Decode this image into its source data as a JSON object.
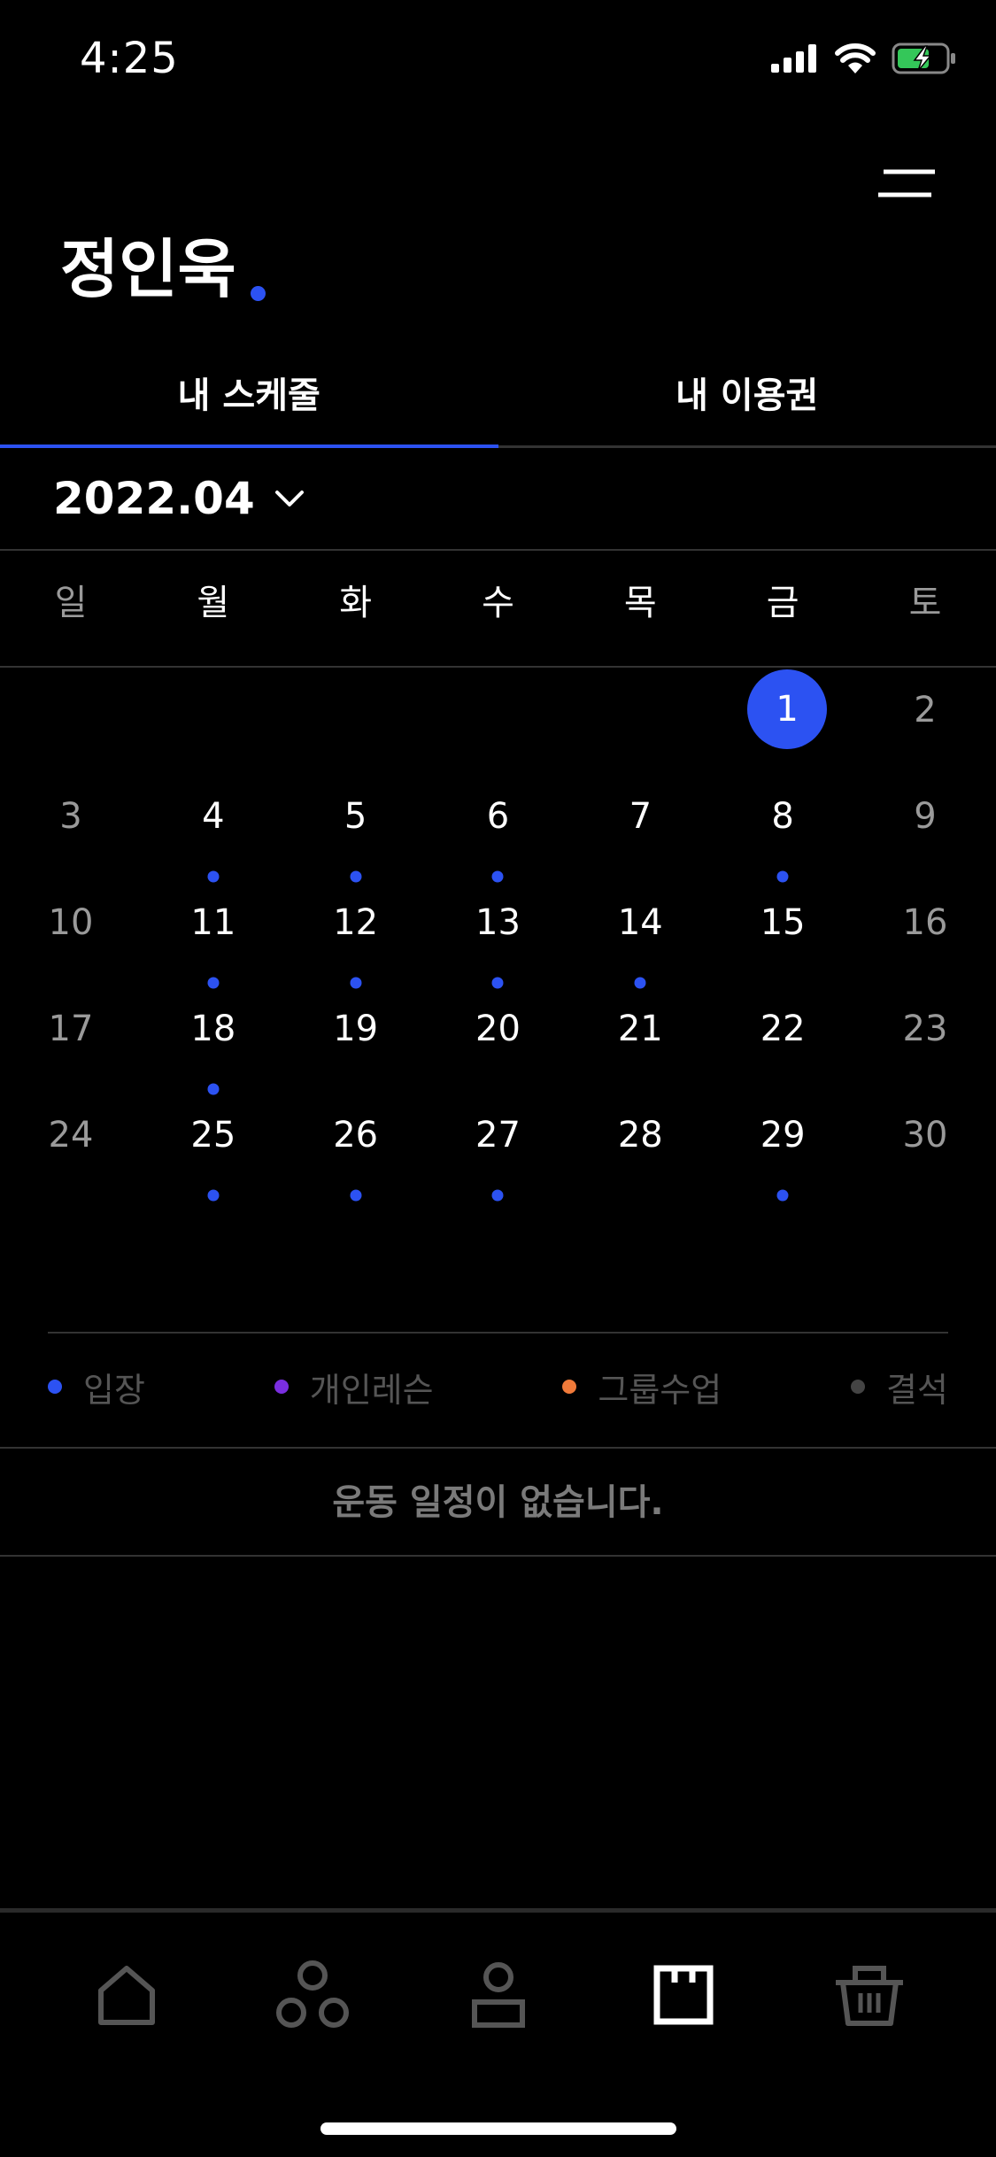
{
  "status": {
    "time": "4:25",
    "icons": [
      "signal-icon",
      "wifi-icon",
      "battery-charging-icon"
    ]
  },
  "header": {
    "name": "정인욱",
    "menu_icon": "menu-icon"
  },
  "tabs": [
    {
      "label": "내 스케줄",
      "active": true
    },
    {
      "label": "내 이용권",
      "active": false
    }
  ],
  "calendar": {
    "month": "2022.04",
    "weekdays": [
      "일",
      "월",
      "화",
      "수",
      "목",
      "금",
      "토"
    ],
    "selected_day": "1",
    "weeks": [
      [
        "",
        "",
        "",
        "",
        "",
        "1",
        "2"
      ],
      [
        "3",
        "4",
        "5",
        "6",
        "7",
        "8",
        "9"
      ],
      [
        "10",
        "11",
        "12",
        "13",
        "14",
        "15",
        "16"
      ],
      [
        "17",
        "18",
        "19",
        "20",
        "21",
        "22",
        "23"
      ],
      [
        "24",
        "25",
        "26",
        "27",
        "28",
        "29",
        "30"
      ]
    ],
    "days_with_entry": [
      "4",
      "5",
      "6",
      "8",
      "11",
      "12",
      "13",
      "14",
      "18",
      "25",
      "26",
      "27",
      "29"
    ]
  },
  "legend": [
    {
      "label": "입장",
      "color": "#2c52f2"
    },
    {
      "label": "개인레슨",
      "color": "#7a2ee0"
    },
    {
      "label": "그룹수업",
      "color": "#f07a3a"
    },
    {
      "label": "결석",
      "color": "#444444"
    }
  ],
  "empty_message": "운동 일정이 없습니다.",
  "colors": {
    "accent": "#2c52f2",
    "background": "#000000"
  },
  "bottom_nav": [
    {
      "icon": "home-icon",
      "active": false
    },
    {
      "icon": "community-icon",
      "active": false
    },
    {
      "icon": "profile-icon",
      "active": false
    },
    {
      "icon": "schedule-icon",
      "active": true
    },
    {
      "icon": "shop-basket-icon",
      "active": false
    }
  ]
}
